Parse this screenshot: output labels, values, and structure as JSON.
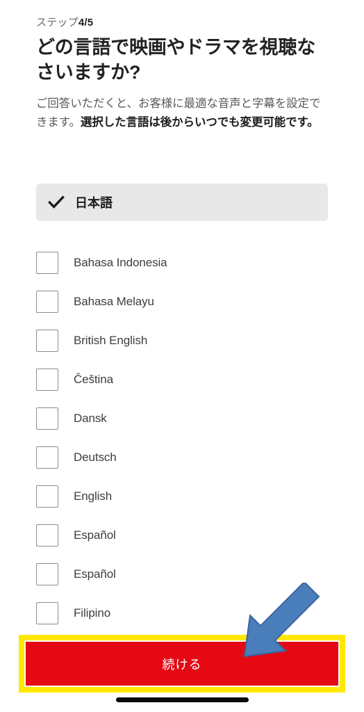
{
  "step": {
    "prefix": "ステップ",
    "count": "4/5"
  },
  "headline": "どの言語で映画やドラマを視聴なさいますか?",
  "subtext": {
    "normal": "ご回答いただくと、お客様に最適な音声と字幕を設定できます。",
    "bold": "選択した言語は後からいつでも変更可能です。"
  },
  "selected_language": {
    "label": "日本語",
    "icon": "check-icon",
    "selected": true
  },
  "languages": [
    {
      "label": "Bahasa Indonesia",
      "checked": false
    },
    {
      "label": "Bahasa Melayu",
      "checked": false
    },
    {
      "label": "British English",
      "checked": false
    },
    {
      "label": "Čeština",
      "checked": false
    },
    {
      "label": "Dansk",
      "checked": false
    },
    {
      "label": "Deutsch",
      "checked": false
    },
    {
      "label": "English",
      "checked": false
    },
    {
      "label": "Español",
      "checked": false
    },
    {
      "label": "Español",
      "checked": false
    },
    {
      "label": "Filipino",
      "checked": false
    }
  ],
  "cta": {
    "label": "続ける"
  },
  "annotations": {
    "highlight_color": "#ffe800",
    "arrow_color": "#4a7ebb",
    "arrow_outline_color": "#3a65a0",
    "arrow_direction": "down-left"
  },
  "colors": {
    "brand_red": "#e50914",
    "selected_row_bg": "#e8e8e8",
    "heading_text": "#222222",
    "body_text": "#5a5a5a",
    "checkbox_border": "#8c8c8c",
    "home_indicator": "#0a0a0a"
  }
}
